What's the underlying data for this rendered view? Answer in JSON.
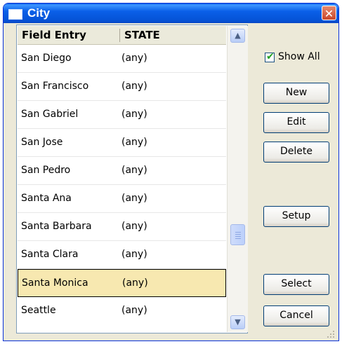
{
  "window": {
    "title": "City"
  },
  "table": {
    "columns": [
      "Field Entry",
      "STATE"
    ],
    "rows": [
      {
        "field": "San Diego",
        "state": "(any)"
      },
      {
        "field": "San Francisco",
        "state": "(any)"
      },
      {
        "field": "San Gabriel",
        "state": "(any)"
      },
      {
        "field": "San Jose",
        "state": "(any)"
      },
      {
        "field": "San Pedro",
        "state": "(any)"
      },
      {
        "field": "Santa Ana",
        "state": "(any)"
      },
      {
        "field": "Santa Barbara",
        "state": "(any)"
      },
      {
        "field": "Santa Clara",
        "state": "(any)"
      },
      {
        "field": "Santa Monica",
        "state": "(any)"
      },
      {
        "field": "Seattle",
        "state": "(any)"
      }
    ],
    "selected_row": "Santa Monica"
  },
  "show_all": {
    "label": "Show All",
    "checked": true
  },
  "buttons": {
    "new": "New",
    "edit": "Edit",
    "delete": "Delete",
    "setup": "Setup",
    "select": "Select",
    "cancel": "Cancel"
  },
  "icons": {
    "close": "close-icon",
    "scroll_up": "chevron-up-icon",
    "scroll_down": "chevron-down-icon",
    "check": "checkmark-icon"
  },
  "colors": {
    "titlebar": "#0a5fe8",
    "selected_row": "#f7e8b0",
    "close_button": "#c9462a",
    "checkmark": "#21a121"
  }
}
